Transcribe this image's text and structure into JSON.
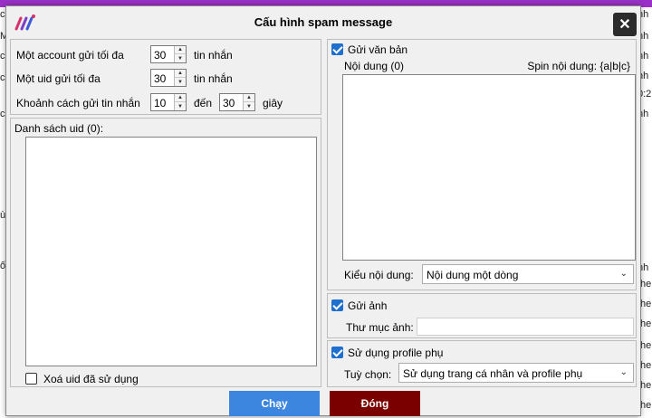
{
  "dialog": {
    "title": "Cấu hình spam message",
    "close_glyph": "✕"
  },
  "limits": {
    "account_label": "Một account gửi tối đa",
    "account_value": "30",
    "account_unit": "tin nhắn",
    "uid_label": "Một uid gửi tối đa",
    "uid_value": "30",
    "uid_unit": "tin nhắn",
    "delay_label": "Khoảnh cách gửi tin nhắn",
    "delay_from": "10",
    "delay_to_label": "đến",
    "delay_to": "30",
    "delay_unit": "giây"
  },
  "uid_list": {
    "label": "Danh sách uid (0):",
    "remove_used_label": "Xoá uid đã sử dụng",
    "remove_used_checked": false
  },
  "send_text": {
    "checkbox_label": "Gửi văn bản",
    "checked": true,
    "content_label": "Nội dung (0)",
    "spin_hint": "Spin nội dung: {a|b|c}",
    "content_type_label": "Kiểu nội dung:",
    "content_type_value": "Nội dung một dòng"
  },
  "send_image": {
    "checkbox_label": "Gửi ảnh",
    "checked": true,
    "folder_label": "Thư mục ảnh:"
  },
  "profile": {
    "checkbox_label": "Sử dụng profile phụ",
    "checked": true,
    "option_label": "Tuỳ chọn:",
    "option_value": "Sử dụng trang cá nhân và profile phụ"
  },
  "actions": {
    "run_label": "Chạy",
    "close_label": "Đóng"
  },
  "colors": {
    "accent": "#1f6fcf",
    "run_button": "#3d86e0",
    "close_button": "#7a0000",
    "window_border": "#9b30c8"
  },
  "background": {
    "right_cells": [
      "nh",
      "nh",
      "nh",
      "nh",
      "0:2",
      "nh",
      "nh",
      "the",
      "the",
      "the",
      "the",
      "the",
      "the",
      "the",
      "the"
    ],
    "left_cells": [
      "cs",
      "Mi",
      "cs",
      "cs",
      "c",
      "ố",
      "ù"
    ]
  }
}
